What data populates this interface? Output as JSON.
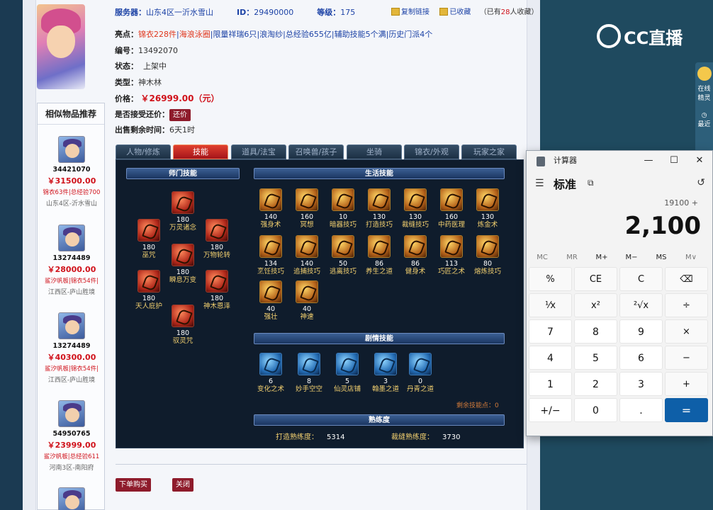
{
  "header": {
    "server_label": "服务器：",
    "server_value": "山东4区一沂水雪山",
    "id_label": "ID：",
    "id_value": "29490000",
    "level_label": "等级：",
    "level_value": "175",
    "copy_link": "复制链接",
    "favorited": "已收藏",
    "fav_prefix": "（已有",
    "fav_count": "28",
    "fav_suffix": "人收藏）"
  },
  "info": {
    "highlight_label": "亮点：",
    "highlights": [
      "锦衣228件",
      "海浪泳圈",
      "限量祥瑞6只",
      "浪淘纱",
      "总经验655亿",
      "辅助技能5个满",
      "历史门派4个"
    ],
    "number_label": "编号：",
    "number_value": "13492070",
    "status_label": "状态：",
    "status_value": "上架中",
    "type_label": "类型：",
    "type_value": "神木林",
    "price_label": "价格：",
    "price_value": "￥26999.00（元）",
    "bargain_label": "是否接受还价：",
    "bargain_button": "还价",
    "remaining_label": "出售剩余时间：",
    "remaining_value": "6天1时"
  },
  "sidebar": {
    "title": "相似物品推荐",
    "items": [
      {
        "id": "34421070",
        "price": "￥31500.00",
        "desc": "锦衣63件|总经验700",
        "server": "山东4区-沂水雪山"
      },
      {
        "id": "13274489",
        "price": "￥28000.00",
        "desc": "鲨汐帆板|锦衣54件|",
        "server": "江西区-庐山胜境"
      },
      {
        "id": "13274489",
        "price": "￥40300.00",
        "desc": "鲨汐帆板|锦衣54件|",
        "server": "江西区-庐山胜境"
      },
      {
        "id": "54950765",
        "price": "￥23999.00",
        "desc": "鲨汐帆板|总经验611",
        "server": "河南3区-南阳府"
      }
    ]
  },
  "tabs": [
    "人物/修炼",
    "技能",
    "道具/法宝",
    "召唤兽/孩子",
    "坐骑",
    "锦衣/外观",
    "玩家之家"
  ],
  "active_tab": "技能",
  "skills": {
    "school_title": "师门技能",
    "school": [
      {
        "level": "180",
        "name": "万灵诸念"
      },
      {
        "level": "180",
        "name": "巫咒"
      },
      {
        "level": "180",
        "name": "万物轮转"
      },
      {
        "level": "180",
        "name": "瞬息万变"
      },
      {
        "level": "180",
        "name": "天人庇护"
      },
      {
        "level": "180",
        "name": "神木恩泽"
      },
      {
        "level": "180",
        "name": "驭灵咒"
      }
    ],
    "life_title": "生活技能",
    "life": [
      {
        "level": "140",
        "name": "强身术"
      },
      {
        "level": "160",
        "name": "冥想"
      },
      {
        "level": "10",
        "name": "暗器技巧"
      },
      {
        "level": "130",
        "name": "打造技巧"
      },
      {
        "level": "130",
        "name": "裁缝技巧"
      },
      {
        "level": "160",
        "name": "中药医理"
      },
      {
        "level": "130",
        "name": "炼金术"
      },
      {
        "level": "134",
        "name": "烹饪技巧"
      },
      {
        "level": "140",
        "name": "追捕技巧"
      },
      {
        "level": "50",
        "name": "逃离技巧"
      },
      {
        "level": "86",
        "name": "养生之道"
      },
      {
        "level": "86",
        "name": "健身术"
      },
      {
        "level": "113",
        "name": "巧匠之术"
      },
      {
        "level": "80",
        "name": "熔炼技巧"
      },
      {
        "level": "40",
        "name": "强壮"
      },
      {
        "level": "40",
        "name": "神速"
      }
    ],
    "plot_title": "剧情技能",
    "plot": [
      {
        "level": "6",
        "name": "变化之术"
      },
      {
        "level": "8",
        "name": "妙手空空"
      },
      {
        "level": "5",
        "name": "仙灵店铺"
      },
      {
        "level": "3",
        "name": "翰墨之道"
      },
      {
        "level": "0",
        "name": "丹青之道"
      }
    ],
    "remaining_points": "剩余技能点：0",
    "proficiency_title": "熟练度",
    "forge_label": "打造熟练度：",
    "forge_value": "5314",
    "tailor_label": "裁缝熟练度：",
    "tailor_value": "3730"
  },
  "actions": {
    "buy": "下单购买",
    "close": "关闭"
  },
  "stream": {
    "logo_text": "CC直播",
    "strip_online": "在线",
    "strip_elf": "精灵",
    "strip_recent": "最近"
  },
  "calculator": {
    "title": "计算器",
    "mode": "标准",
    "expression": "19100 +",
    "display": "2,100",
    "memory": [
      "MC",
      "MR",
      "M+",
      "M−",
      "MS",
      "M∨"
    ],
    "keys": [
      "%",
      "CE",
      "C",
      "⌫",
      "¹⁄x",
      "x²",
      "²√x",
      "÷",
      "7",
      "8",
      "9",
      "×",
      "4",
      "5",
      "6",
      "−",
      "1",
      "2",
      "3",
      "+",
      "+/−",
      "0",
      ".",
      "="
    ]
  }
}
